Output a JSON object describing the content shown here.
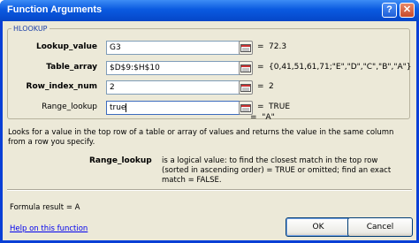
{
  "window": {
    "title": "Function Arguments"
  },
  "title_buttons": {
    "help": "?",
    "close": "✕"
  },
  "group": {
    "title": "HLOOKUP"
  },
  "args": [
    {
      "label": "Lookup_value",
      "bold": true,
      "value": "G3",
      "result": "72.3"
    },
    {
      "label": "Table_array",
      "bold": true,
      "value": "$D$9:$H$10",
      "result": "{0,41,51,61,71;\"E\",\"D\",\"C\",\"B\",\"A\"}"
    },
    {
      "label": "Row_index_num",
      "bold": true,
      "value": "2",
      "result": "2"
    },
    {
      "label": "Range_lookup",
      "bold": false,
      "value": "true",
      "result": "TRUE"
    }
  ],
  "equals": "=",
  "function_result": "\"A\"",
  "description": "Looks for a value in the top row of a table or array of values and returns the value in the same column from a row you specify.",
  "current_arg": {
    "name": "Range_lookup",
    "text": "is a logical value: to find the closest match in the top row (sorted in ascending order) = TRUE or omitted; find an exact match = FALSE."
  },
  "formula_result": "Formula result =   A",
  "help_link": "Help on this function",
  "buttons": {
    "ok": "OK",
    "cancel": "Cancel"
  },
  "icons": {
    "collapse_dialog": "collapse-dialog-icon"
  }
}
